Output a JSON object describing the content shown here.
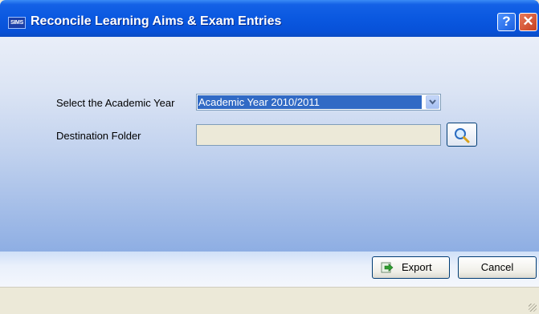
{
  "window": {
    "title": "Reconcile Learning Aims & Exam Entries",
    "app_icon_text": "SIMS",
    "help_label": "?",
    "close_label": "✕"
  },
  "form": {
    "academic_year_label": "Select the Academic Year",
    "academic_year_value": "Academic Year 2010/2011",
    "destination_label": "Destination Folder",
    "destination_value": ""
  },
  "buttons": {
    "export_label": "Export",
    "cancel_label": "Cancel"
  }
}
